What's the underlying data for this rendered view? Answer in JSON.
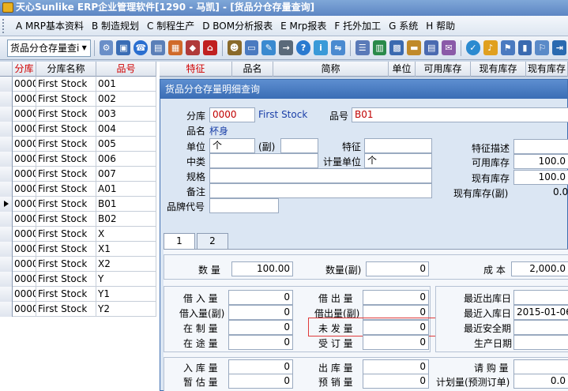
{
  "window": {
    "title": "天心Sunlike ERP企业管理软件[1290 - 马凯] - [货品分仓存量查询]"
  },
  "menu": [
    "A MRP基本资料",
    "B 制造规划",
    "C 制程生产",
    "D BOM分析报表",
    "E Mrp报表",
    "F 托外加工",
    "G 系统",
    "H 帮助"
  ],
  "toolbar": {
    "combo_value": "货品分仓存量查i"
  },
  "grid": {
    "headers": [
      "分库",
      "分库名称",
      "品号",
      "特征"
    ],
    "rows": [
      [
        "0000",
        "First Stock",
        "001"
      ],
      [
        "0000",
        "First Stock",
        "002"
      ],
      [
        "0000",
        "First Stock",
        "003"
      ],
      [
        "0000",
        "First Stock",
        "004"
      ],
      [
        "0000",
        "First Stock",
        "005"
      ],
      [
        "0000",
        "First Stock",
        "006"
      ],
      [
        "0000",
        "First Stock",
        "007"
      ],
      [
        "0000",
        "First Stock",
        "A01"
      ],
      [
        "0000",
        "First Stock",
        "B01"
      ],
      [
        "0000",
        "First Stock",
        "B02"
      ],
      [
        "0000",
        "First Stock",
        "X"
      ],
      [
        "0000",
        "First Stock",
        "X1"
      ],
      [
        "0000",
        "First Stock",
        "X2"
      ],
      [
        "0000",
        "First Stock",
        "Y"
      ],
      [
        "0000",
        "First Stock",
        "Y1"
      ],
      [
        "0000",
        "First Stock",
        "Y2"
      ]
    ],
    "right_headers": [
      "品名",
      "简称",
      "单位",
      "可用库存",
      "现有库存",
      "现有库存"
    ]
  },
  "dialog": {
    "title": "货品分仓存量明细查询",
    "warehouse_label": "分库",
    "warehouse_code": "0000",
    "warehouse_name": "First Stock",
    "item_label": "品号",
    "item_code": "B01",
    "name_label": "品名",
    "name_value": "杯身",
    "unit_label": "单位",
    "unit_value": "个",
    "sub_label": "(副)",
    "feature_label": "特征",
    "feature_desc_label": "特征描述",
    "category_label": "中类",
    "calc_unit_label": "计量单位",
    "calc_unit_value": "个",
    "avail_label": "可用库存",
    "avail_value": "100.0",
    "spec_label": "规格",
    "onhand_label": "现有库存",
    "onhand_value": "100.0",
    "remark_label": "备注",
    "onhand_sub_label": "现有库存(副)",
    "onhand_sub_value": "0.0",
    "brand_label": "品牌代号",
    "tabs": [
      "1",
      "2"
    ],
    "qty_label": "数 量",
    "qty_value": "100.00",
    "qty_sub_label": "数量(副)",
    "qty_sub_value": "0",
    "cost_label": "成 本",
    "cost_value": "2,000.0",
    "borrow_in_label": "借 入 量",
    "borrow_in_value": "0",
    "borrow_in_sub_label": "借入量(副)",
    "borrow_in_sub_value": "0",
    "wip_label": "在 制 量",
    "wip_value": "0",
    "transit_label": "在 途 量",
    "transit_value": "0",
    "borrow_out_label": "借 出 量",
    "borrow_out_value": "0",
    "borrow_out_sub_label": "借出量(副)",
    "borrow_out_sub_value": "0",
    "unshipped_label": "未 发 量",
    "unshipped_value": "0",
    "ordered_label": "受 订 量",
    "ordered_value": "0",
    "last_out_label": "最近出库日",
    "last_out_value": "",
    "last_in_label": "最近入库日",
    "last_in_value": "2015-01-06",
    "last_safe_label": "最近安全期",
    "last_safe_value": "",
    "prod_date_label": "生产日期",
    "prod_date_value": "",
    "in_qty_label": "入 库 量",
    "in_qty_value": "0",
    "est_qty_label": "暂 估 量",
    "est_qty_value": "0",
    "out_qty_label": "出 库 量",
    "out_qty_value": "0",
    "presale_label": "预 销 量",
    "presale_value": "0",
    "purchase_label": "请 购 量",
    "purchase_value": "",
    "plan_label": "计划量(预测订单)",
    "plan_value": "0.0"
  }
}
